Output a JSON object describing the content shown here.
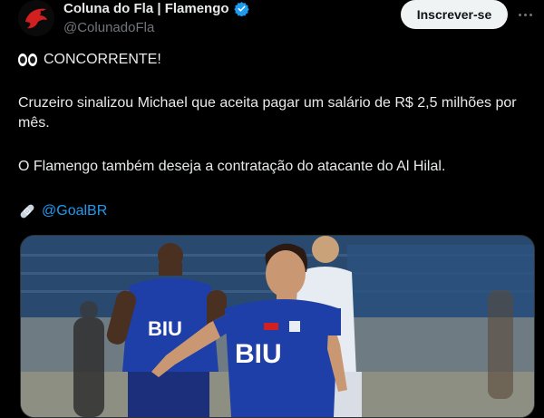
{
  "author": {
    "display_name": "Coluna do Fla | Flamengo",
    "handle": "@ColunadoFla",
    "verified": true,
    "avatar_icon": "vulture-logo-icon"
  },
  "actions": {
    "follow_label": "Inscrever-se",
    "more_icon": "more-horizontal-icon"
  },
  "tweet": {
    "line1_icon": "eyes-icon",
    "line1_text": "CONCORRENTE!",
    "line2_text": "Cruzeiro sinalizou Michael que aceita pagar um salário de R$ 2,5 milhões por mês.",
    "line3_text": "O Flamengo também deseja a contratação do atacante do Al Hilal.",
    "source_icon": "bandage-icon",
    "source_link": "@GoalBR"
  },
  "media": {
    "jersey_sponsor": "BIU",
    "jersey_sponsor_back": "BIU"
  },
  "colors": {
    "background": "#000000",
    "text": "#e7e9ea",
    "secondary": "#71767b",
    "link": "#1d9bf0",
    "verified": "#1d9bf0",
    "jersey": "#1f3fa8"
  }
}
